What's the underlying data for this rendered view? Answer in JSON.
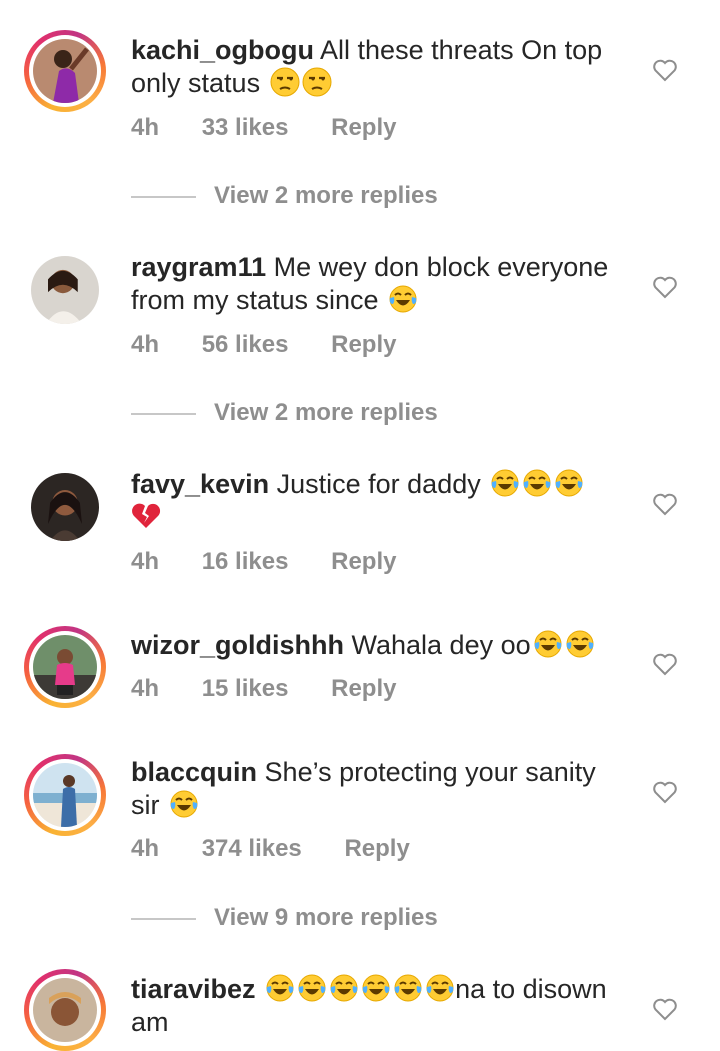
{
  "comments": [
    {
      "username": "kachi_ogbogu",
      "text": "All these threats On top only status",
      "emojis": [
        "unamused",
        "unamused"
      ],
      "time": "4h",
      "likes": "33 likes",
      "reply": "Reply",
      "view_replies": "View 2 more replies"
    },
    {
      "username": "raygram11",
      "text": "Me wey don block everyone from my status since",
      "emojis": [
        "joy"
      ],
      "time": "4h",
      "likes": "56 likes",
      "reply": "Reply",
      "view_replies": "View 2 more replies"
    },
    {
      "username": "favy_kevin",
      "text": "Justice for daddy",
      "emojis": [
        "joy",
        "joy",
        "joy",
        "broken-heart"
      ],
      "time": "4h",
      "likes": "16 likes",
      "reply": "Reply"
    },
    {
      "username": "wizor_goldishhh",
      "text": "Wahala dey oo",
      "emojis": [
        "joy",
        "joy"
      ],
      "time": "4h",
      "likes": "15 likes",
      "reply": "Reply"
    },
    {
      "username": "blaccquin",
      "text": "She’s protecting your sanity sir",
      "emojis": [
        "joy"
      ],
      "time": "4h",
      "likes": "374 likes",
      "reply": "Reply",
      "view_replies": "View 9 more replies"
    },
    {
      "username": "tiaravibez",
      "text": "na to disown am",
      "emojis": [
        "joy",
        "joy",
        "joy",
        "joy",
        "joy",
        "joy"
      ]
    }
  ]
}
